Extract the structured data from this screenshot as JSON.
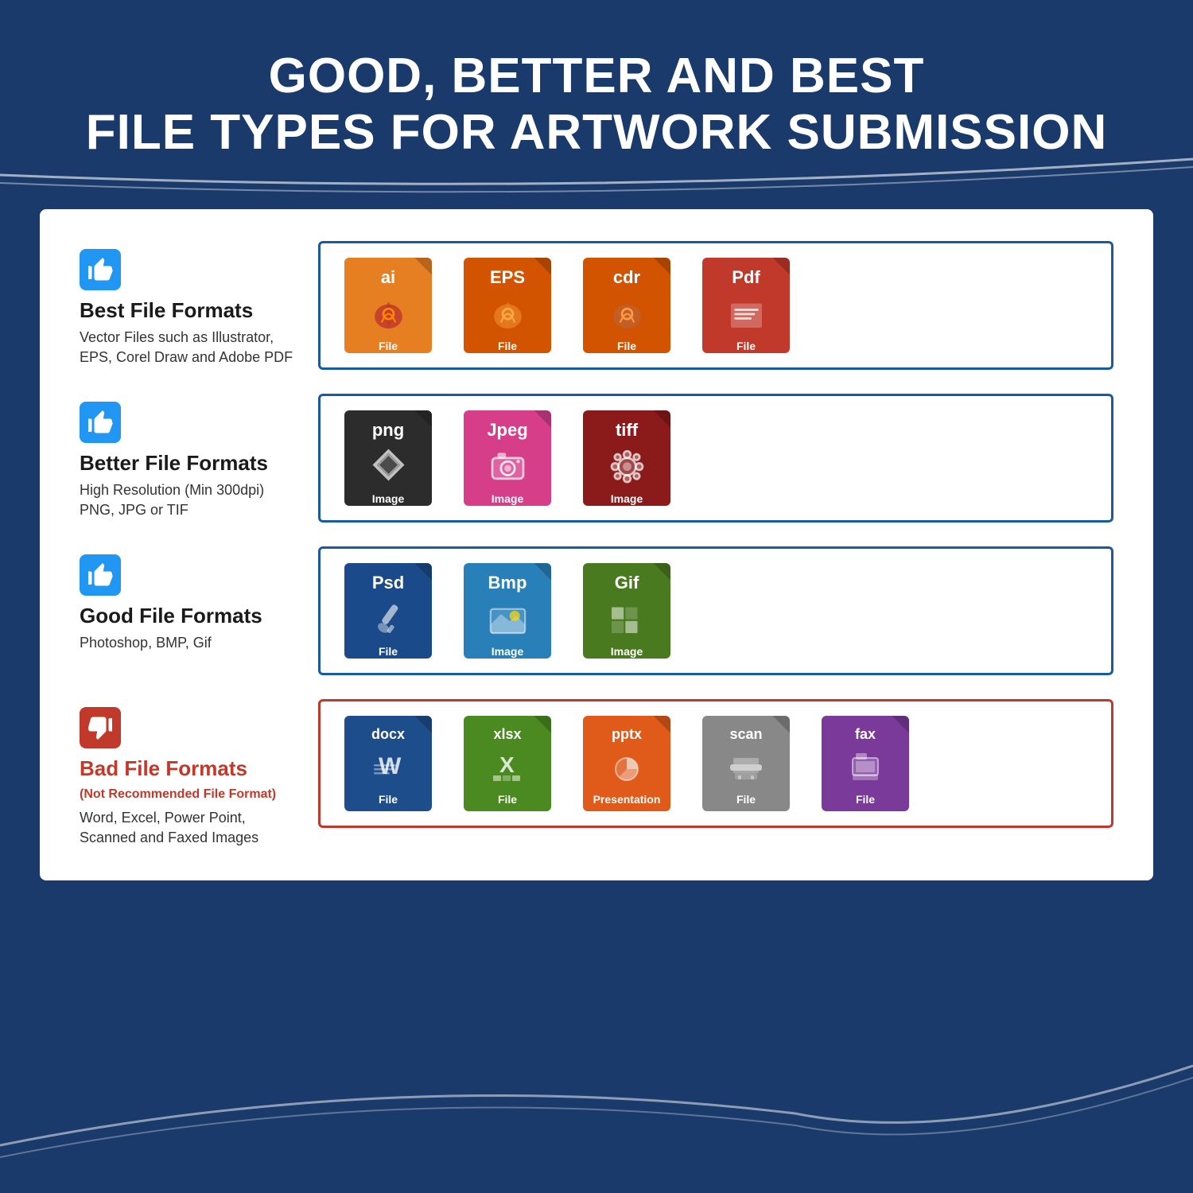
{
  "header": {
    "line1": "GOOD, BETTER AND BEST",
    "line2": "FILE TYPES FOR ARTWORK SUBMISSION"
  },
  "rows": [
    {
      "id": "best",
      "thumbType": "up",
      "title": "Best File Formats",
      "subtitle": "Vector Files such as Illustrator,\nEPS, Corel Draw and Adobe PDF",
      "borderClass": "blue-border",
      "files": [
        {
          "ext": "ai",
          "color": "orange",
          "label": "File",
          "graphic": "pen"
        },
        {
          "ext": "EPS",
          "color": "dark-orange",
          "label": "File",
          "graphic": "pen"
        },
        {
          "ext": "cdr",
          "color": "dark-orange",
          "label": "File",
          "graphic": "pen"
        },
        {
          "ext": "Pdf",
          "color": "red-file",
          "label": "File",
          "graphic": "pdf"
        }
      ]
    },
    {
      "id": "better",
      "thumbType": "up",
      "title": "Better File Formats",
      "subtitle": "High Resolution (Min 300dpi)\nPNG, JPG or TIF",
      "borderClass": "blue-border",
      "files": [
        {
          "ext": "png",
          "color": "dark-gray",
          "label": "Image",
          "graphic": "star"
        },
        {
          "ext": "Jpeg",
          "color": "pink",
          "label": "Image",
          "graphic": "camera"
        },
        {
          "ext": "tiff",
          "color": "dark-red",
          "label": "Image",
          "graphic": "gear"
        }
      ]
    },
    {
      "id": "good",
      "thumbType": "up",
      "title": "Good File Formats",
      "subtitle": "Photoshop, BMP, Gif",
      "borderClass": "blue-border",
      "files": [
        {
          "ext": "Psd",
          "color": "dark-blue",
          "label": "File",
          "graphic": "brush"
        },
        {
          "ext": "Bmp",
          "color": "blue-file",
          "label": "Image",
          "graphic": "landscape"
        },
        {
          "ext": "Gif",
          "color": "olive-green",
          "label": "Image",
          "graphic": "grid"
        }
      ]
    },
    {
      "id": "bad",
      "thumbType": "down",
      "title": "Bad File Formats",
      "titleSub": "(Not Recommended File Format)",
      "subtitle": "Word, Excel, Power Point,\nScanned and Faxed Images",
      "borderClass": "red-border",
      "files": [
        {
          "ext": "docx",
          "color": "blue-docx",
          "label": "File",
          "graphic": "word"
        },
        {
          "ext": "xlsx",
          "color": "green-xlsx",
          "label": "File",
          "graphic": "excel"
        },
        {
          "ext": "pptx",
          "color": "orange-pptx",
          "label": "Presentation",
          "graphic": "ppt"
        },
        {
          "ext": "scan",
          "color": "gray-scan",
          "label": "File",
          "graphic": "scanner"
        },
        {
          "ext": "fax",
          "color": "purple-fax",
          "label": "File",
          "graphic": "fax"
        }
      ]
    }
  ]
}
